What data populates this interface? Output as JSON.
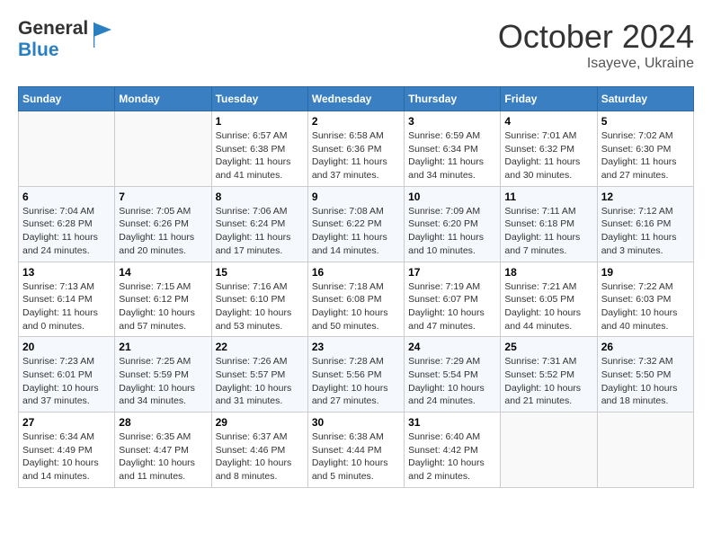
{
  "header": {
    "logo_general": "General",
    "logo_blue": "Blue",
    "month": "October 2024",
    "location": "Isayeve, Ukraine"
  },
  "days_of_week": [
    "Sunday",
    "Monday",
    "Tuesday",
    "Wednesday",
    "Thursday",
    "Friday",
    "Saturday"
  ],
  "weeks": [
    [
      {
        "day": "",
        "info": ""
      },
      {
        "day": "",
        "info": ""
      },
      {
        "day": "1",
        "info": "Sunrise: 6:57 AM\nSunset: 6:38 PM\nDaylight: 11 hours and 41 minutes."
      },
      {
        "day": "2",
        "info": "Sunrise: 6:58 AM\nSunset: 6:36 PM\nDaylight: 11 hours and 37 minutes."
      },
      {
        "day": "3",
        "info": "Sunrise: 6:59 AM\nSunset: 6:34 PM\nDaylight: 11 hours and 34 minutes."
      },
      {
        "day": "4",
        "info": "Sunrise: 7:01 AM\nSunset: 6:32 PM\nDaylight: 11 hours and 30 minutes."
      },
      {
        "day": "5",
        "info": "Sunrise: 7:02 AM\nSunset: 6:30 PM\nDaylight: 11 hours and 27 minutes."
      }
    ],
    [
      {
        "day": "6",
        "info": "Sunrise: 7:04 AM\nSunset: 6:28 PM\nDaylight: 11 hours and 24 minutes."
      },
      {
        "day": "7",
        "info": "Sunrise: 7:05 AM\nSunset: 6:26 PM\nDaylight: 11 hours and 20 minutes."
      },
      {
        "day": "8",
        "info": "Sunrise: 7:06 AM\nSunset: 6:24 PM\nDaylight: 11 hours and 17 minutes."
      },
      {
        "day": "9",
        "info": "Sunrise: 7:08 AM\nSunset: 6:22 PM\nDaylight: 11 hours and 14 minutes."
      },
      {
        "day": "10",
        "info": "Sunrise: 7:09 AM\nSunset: 6:20 PM\nDaylight: 11 hours and 10 minutes."
      },
      {
        "day": "11",
        "info": "Sunrise: 7:11 AM\nSunset: 6:18 PM\nDaylight: 11 hours and 7 minutes."
      },
      {
        "day": "12",
        "info": "Sunrise: 7:12 AM\nSunset: 6:16 PM\nDaylight: 11 hours and 3 minutes."
      }
    ],
    [
      {
        "day": "13",
        "info": "Sunrise: 7:13 AM\nSunset: 6:14 PM\nDaylight: 11 hours and 0 minutes."
      },
      {
        "day": "14",
        "info": "Sunrise: 7:15 AM\nSunset: 6:12 PM\nDaylight: 10 hours and 57 minutes."
      },
      {
        "day": "15",
        "info": "Sunrise: 7:16 AM\nSunset: 6:10 PM\nDaylight: 10 hours and 53 minutes."
      },
      {
        "day": "16",
        "info": "Sunrise: 7:18 AM\nSunset: 6:08 PM\nDaylight: 10 hours and 50 minutes."
      },
      {
        "day": "17",
        "info": "Sunrise: 7:19 AM\nSunset: 6:07 PM\nDaylight: 10 hours and 47 minutes."
      },
      {
        "day": "18",
        "info": "Sunrise: 7:21 AM\nSunset: 6:05 PM\nDaylight: 10 hours and 44 minutes."
      },
      {
        "day": "19",
        "info": "Sunrise: 7:22 AM\nSunset: 6:03 PM\nDaylight: 10 hours and 40 minutes."
      }
    ],
    [
      {
        "day": "20",
        "info": "Sunrise: 7:23 AM\nSunset: 6:01 PM\nDaylight: 10 hours and 37 minutes."
      },
      {
        "day": "21",
        "info": "Sunrise: 7:25 AM\nSunset: 5:59 PM\nDaylight: 10 hours and 34 minutes."
      },
      {
        "day": "22",
        "info": "Sunrise: 7:26 AM\nSunset: 5:57 PM\nDaylight: 10 hours and 31 minutes."
      },
      {
        "day": "23",
        "info": "Sunrise: 7:28 AM\nSunset: 5:56 PM\nDaylight: 10 hours and 27 minutes."
      },
      {
        "day": "24",
        "info": "Sunrise: 7:29 AM\nSunset: 5:54 PM\nDaylight: 10 hours and 24 minutes."
      },
      {
        "day": "25",
        "info": "Sunrise: 7:31 AM\nSunset: 5:52 PM\nDaylight: 10 hours and 21 minutes."
      },
      {
        "day": "26",
        "info": "Sunrise: 7:32 AM\nSunset: 5:50 PM\nDaylight: 10 hours and 18 minutes."
      }
    ],
    [
      {
        "day": "27",
        "info": "Sunrise: 6:34 AM\nSunset: 4:49 PM\nDaylight: 10 hours and 14 minutes."
      },
      {
        "day": "28",
        "info": "Sunrise: 6:35 AM\nSunset: 4:47 PM\nDaylight: 10 hours and 11 minutes."
      },
      {
        "day": "29",
        "info": "Sunrise: 6:37 AM\nSunset: 4:46 PM\nDaylight: 10 hours and 8 minutes."
      },
      {
        "day": "30",
        "info": "Sunrise: 6:38 AM\nSunset: 4:44 PM\nDaylight: 10 hours and 5 minutes."
      },
      {
        "day": "31",
        "info": "Sunrise: 6:40 AM\nSunset: 4:42 PM\nDaylight: 10 hours and 2 minutes."
      },
      {
        "day": "",
        "info": ""
      },
      {
        "day": "",
        "info": ""
      }
    ]
  ]
}
